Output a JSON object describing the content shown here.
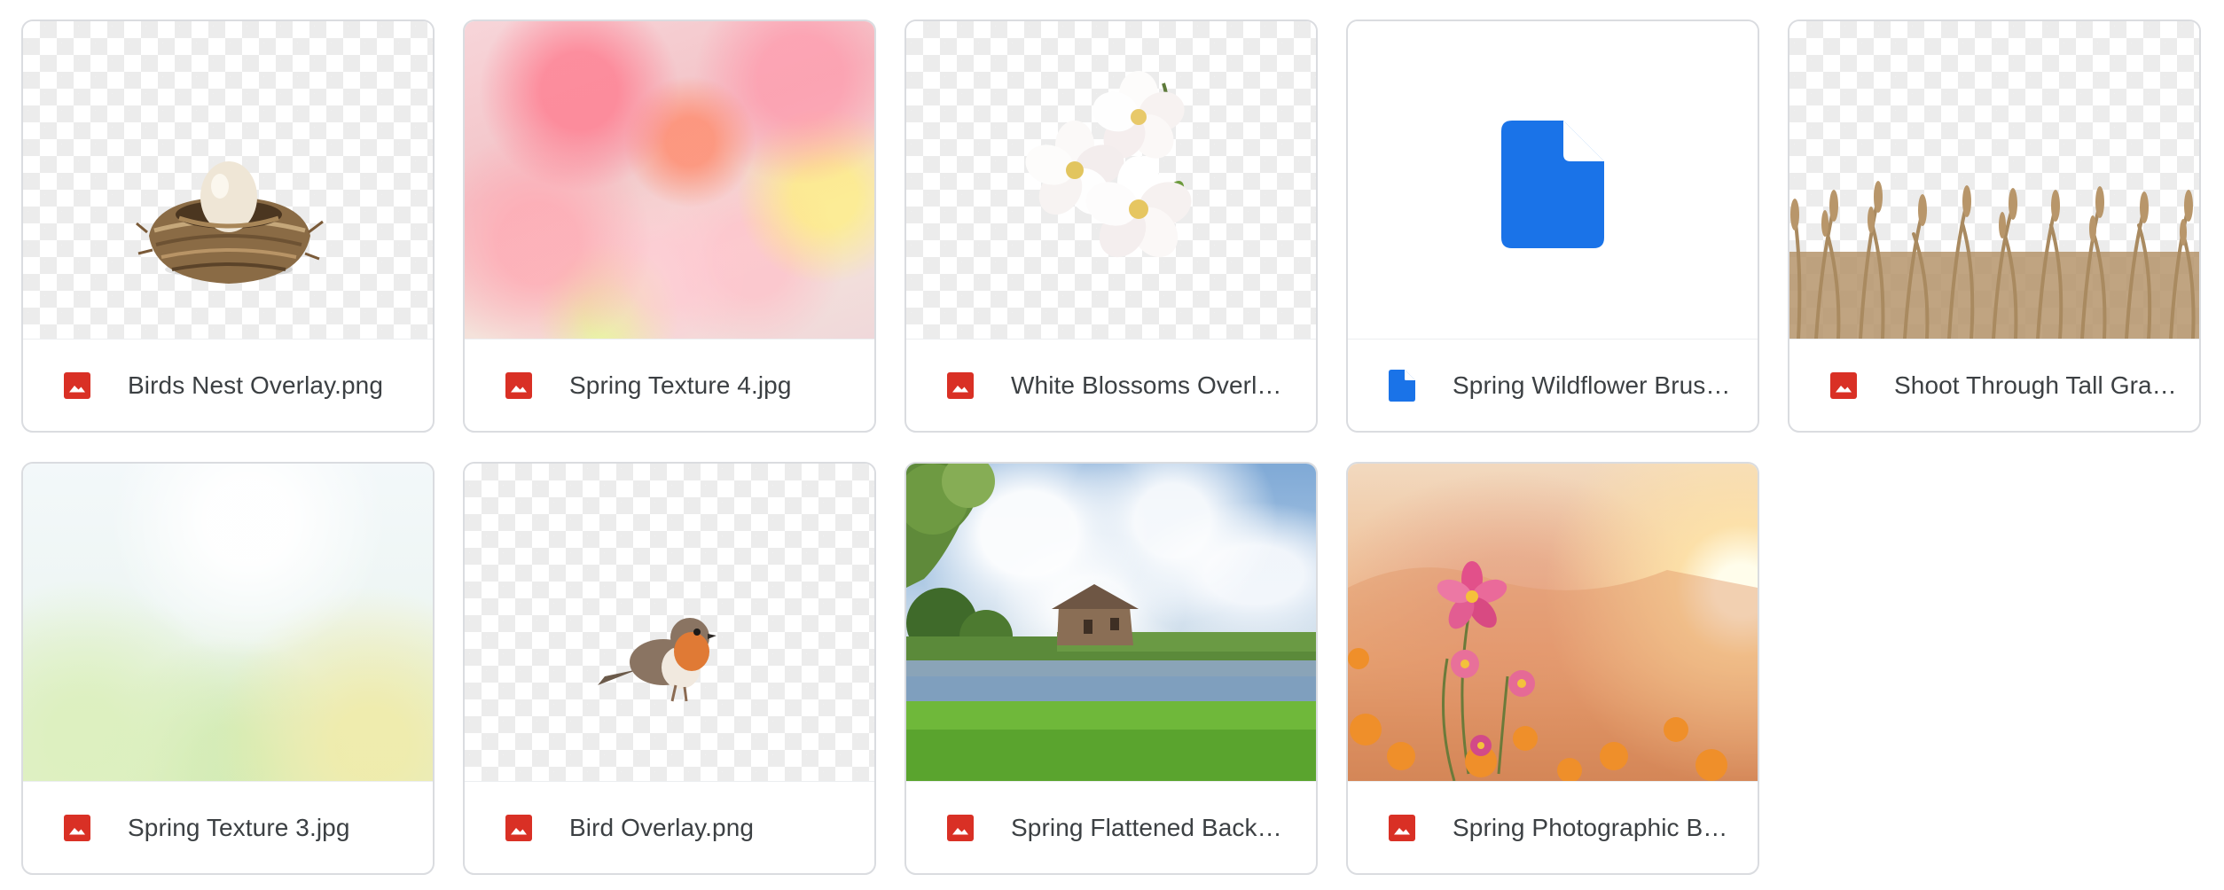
{
  "files": [
    {
      "name": "Birds Nest Overlay.png",
      "type": "image",
      "thumb": "nest"
    },
    {
      "name": "Spring Texture 4.jpg",
      "type": "image",
      "thumb": "spring4"
    },
    {
      "name": "White Blossoms Overl…",
      "type": "image",
      "thumb": "blossoms"
    },
    {
      "name": "Spring Wildflower Brus…",
      "type": "document",
      "thumb": "doc"
    },
    {
      "name": "Shoot Through Tall Gra…",
      "type": "image",
      "thumb": "grass"
    },
    {
      "name": "Spring Texture 3.jpg",
      "type": "image",
      "thumb": "spring3"
    },
    {
      "name": "Bird Overlay.png",
      "type": "image",
      "thumb": "bird"
    },
    {
      "name": "Spring Flattened Back…",
      "type": "image",
      "thumb": "flattened"
    },
    {
      "name": "Spring Photographic B…",
      "type": "image",
      "thumb": "photographic"
    }
  ],
  "icons": {
    "image": "image-file-icon",
    "document": "document-file-icon"
  },
  "colors": {
    "image_icon": "#d93025",
    "doc_icon": "#1a73e8",
    "card_border": "#dadce0",
    "text": "#3c4043"
  }
}
